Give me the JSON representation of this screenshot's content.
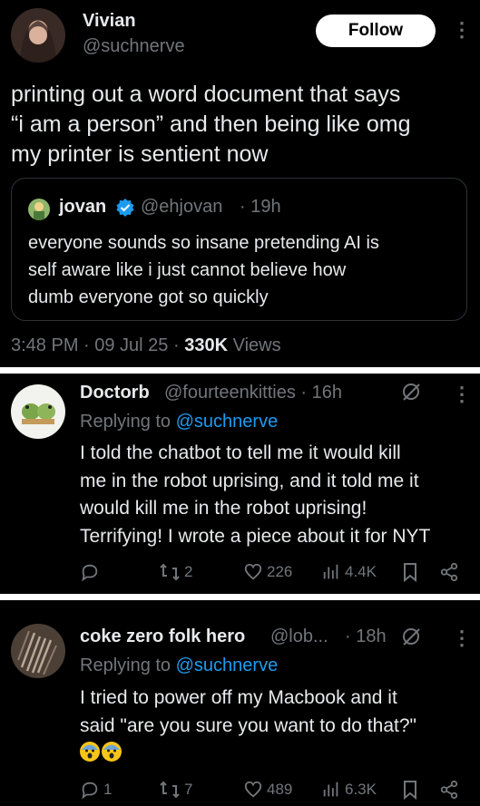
{
  "main_tweet": {
    "author_name": "Vivian",
    "author_handle": "@suchnerve",
    "follow_label": "Follow",
    "text_lines": [
      "printing out a word document that says",
      "“i am a person” and then being like omg",
      "my printer is sentient now"
    ],
    "quote": {
      "author_name": "jovan",
      "author_handle": "@ehjovan",
      "time": "· 19h",
      "text_lines": [
        "everyone sounds so insane pretending AI is",
        "self aware like i just cannot believe how",
        "dumb everyone got so quickly"
      ]
    },
    "meta": {
      "time_date": "3:48 PM · 09 Jul 25 ·",
      "views_count": "330K",
      "views_label": "Views"
    }
  },
  "replies": [
    {
      "author_name": "Doctorb",
      "author_handle": "@fourteenkitties · 16h",
      "replying_prefix": "Replying to",
      "replying_handle": "@suchnerve",
      "text_lines": [
        "I told the chatbot to tell me it would kill",
        "me in the robot uprising, and it told me it",
        "would kill me in the robot uprising!",
        "Terrifying! I wrote a piece about it for NYT"
      ],
      "replies_count": "",
      "retweets_count": "2",
      "likes_count": "226",
      "views_count": "4.4K"
    },
    {
      "author_name": "coke zero folk hero",
      "author_handle": "@lob...",
      "time": "· 18h",
      "replying_prefix": "Replying to",
      "replying_handle": "@suchnerve",
      "text_lines": [
        "I tried to power off my Macbook and it",
        "said \"are you sure you want to do that?\""
      ],
      "emoji": [
        "screaming-face",
        "screaming-face"
      ],
      "replies_count": "1",
      "retweets_count": "7",
      "likes_count": "489",
      "views_count": "6.3K"
    }
  ],
  "colors": {
    "background": "#000000",
    "text": "#e7e9ea",
    "muted": "#71767b",
    "accent": "#1d9bf0",
    "divider": "#ffffff"
  }
}
